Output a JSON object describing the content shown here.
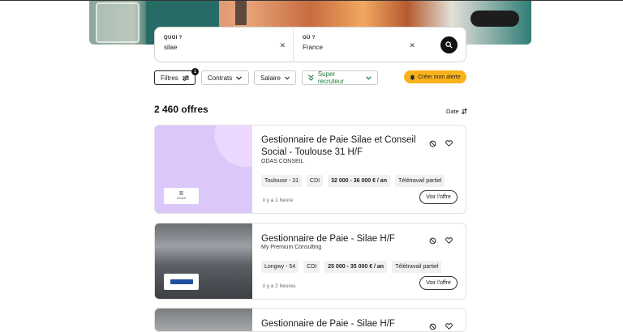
{
  "search": {
    "what_label": "QUOI ?",
    "what_value": "silae",
    "where_label": "OÙ ?",
    "where_value": "France"
  },
  "filters": {
    "filters_label": "Filtres",
    "filters_badge": "1",
    "contracts_label": "Contrats",
    "salary_label": "Salaire",
    "super_label": "Super recruteur",
    "alert_label": "Créer mon alerte"
  },
  "results": {
    "count": "2 460 offres",
    "sort_label": "Date"
  },
  "jobs": [
    {
      "title": "Gestionnaire de Paie Silae et Conseil Social - Toulouse 31 H/F",
      "company": "ODAS CONSEIL",
      "tags": [
        "Toulouse - 31",
        "CDI",
        "32 000 - 36 000 € / an",
        "Télétravail partiel"
      ],
      "posted": "il y a 1 heure",
      "apply": "Voir l'offre",
      "logo_text": "ODAS"
    },
    {
      "title": "Gestionnaire de Paie - Silae H/F",
      "company": "My Premium Consulting",
      "tags": [
        "Longwy - 54",
        "CDI",
        "25 000 - 35 000 € / an",
        "Télétravail partiel"
      ],
      "posted": "il y a 2 heures",
      "apply": "Voir l'offre"
    },
    {
      "title": "Gestionnaire de Paie - Silae H/F"
    }
  ],
  "colors": {
    "alert_bg": "#f9b21b",
    "super_recruiter": "#1f7a3b",
    "card1_thumb": "#dcc7fb"
  }
}
